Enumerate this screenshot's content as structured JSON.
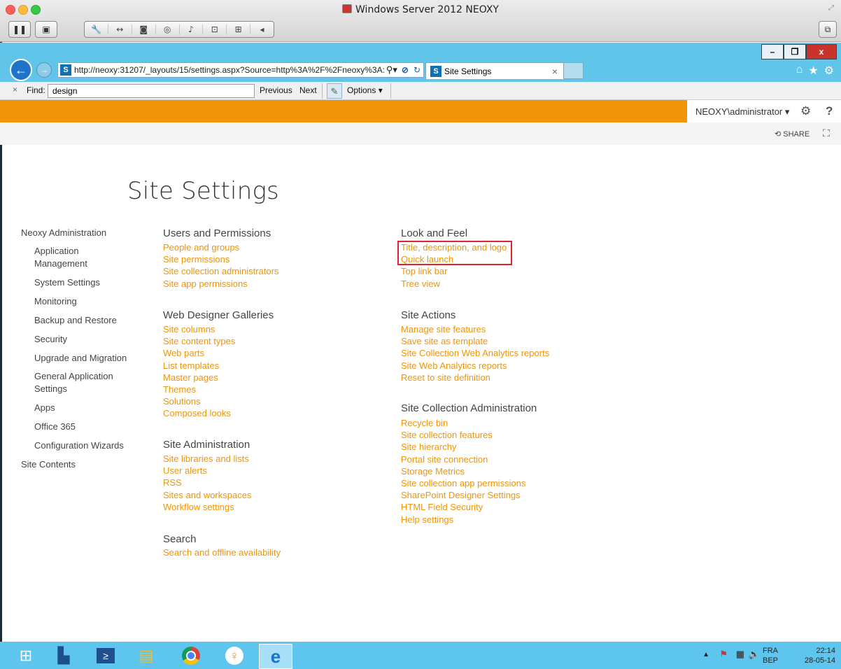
{
  "mac_window": {
    "title": "Windows Server 2012 NEOXY"
  },
  "ie": {
    "window_controls": {
      "minimize": "–",
      "restore": "❐",
      "close": "x"
    },
    "address_url": "http://neoxy:31207/_layouts/15/settings.aspx?Source=http%3A%2F%2Fneoxy%3A:",
    "tab_title": "Site Settings",
    "tab_close": "×",
    "icons": [
      "home-icon",
      "favorites-star-icon",
      "gear-icon"
    ]
  },
  "find_bar": {
    "close": "×",
    "label": "Find:",
    "value": "design",
    "previous": "Previous",
    "next": "Next",
    "options": "Options"
  },
  "suite_bar": {
    "user": "NEOXY\\administrator",
    "help": "?"
  },
  "actions_bar": {
    "share": "SHARE"
  },
  "page": {
    "title": "Site Settings",
    "quick_launch": {
      "root": "Neoxy Administration",
      "items": [
        "Application Management",
        "System Settings",
        "Monitoring",
        "Backup and Restore",
        "Security",
        "Upgrade and Migration",
        "General Application Settings",
        "Apps",
        "Office 365",
        "Configuration Wizards"
      ],
      "site_contents": "Site Contents"
    },
    "sections": {
      "users": {
        "title": "Users and Permissions",
        "links": [
          "People and groups",
          "Site permissions",
          "Site collection administrators",
          "Site app permissions"
        ]
      },
      "galleries": {
        "title": "Web Designer Galleries",
        "links": [
          "Site columns",
          "Site content types",
          "Web parts",
          "List templates",
          "Master pages",
          "Themes",
          "Solutions",
          "Composed looks"
        ]
      },
      "site_admin": {
        "title": "Site Administration",
        "links": [
          "Site libraries and lists",
          "User alerts",
          "RSS",
          "Sites and workspaces",
          "Workflow settings"
        ]
      },
      "search": {
        "title": "Search",
        "links": [
          "Search and offline availability"
        ]
      },
      "look": {
        "title": "Look and Feel",
        "links": [
          "Title, description, and logo",
          "Quick launch",
          "Top link bar",
          "Tree view"
        ]
      },
      "site_actions": {
        "title": "Site Actions",
        "links": [
          "Manage site features",
          "Save site as template",
          "Site Collection Web Analytics reports",
          "Site Web Analytics reports",
          "Reset to site definition"
        ]
      },
      "collection_admin": {
        "title": "Site Collection Administration",
        "links": [
          "Recycle bin",
          "Site collection features",
          "Site hierarchy",
          "Portal site connection",
          "Storage Metrics",
          "Site collection app permissions",
          "SharePoint Designer Settings",
          "HTML Field Security",
          "Help settings"
        ]
      }
    }
  },
  "taskbar": {
    "lang": "FRA",
    "lang2": "BEP",
    "time": "22:14",
    "date": "28-05-14"
  },
  "colors": {
    "accent": "#f0940a",
    "taskbar": "#5ec5ee",
    "highlight": "#e0232e"
  }
}
